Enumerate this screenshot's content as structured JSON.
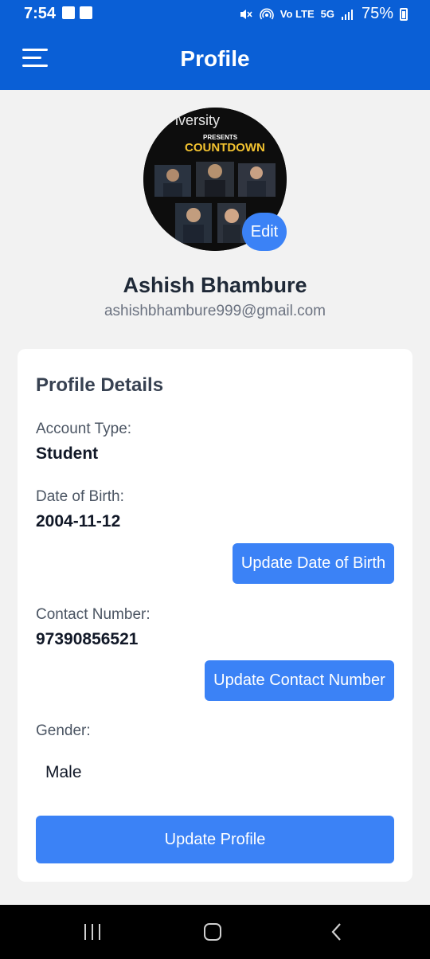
{
  "status_bar": {
    "time": "7:54",
    "network": "5G",
    "battery": "75%"
  },
  "header": {
    "title": "Profile",
    "menu_icon": "hamburger-menu-icon"
  },
  "profile": {
    "avatar_text": {
      "line1": "iversity",
      "line2": "PRESENTS",
      "line3": "COUNTDOWN"
    },
    "edit_label": "Edit",
    "name": "Ashish Bhambure",
    "email": "ashishbhambure999@gmail.com"
  },
  "details": {
    "title": "Profile Details",
    "account_type_label": "Account Type:",
    "account_type_value": "Student",
    "dob_label": "Date of Birth:",
    "dob_value": "2004-11-12",
    "update_dob_label": "Update Date of Birth",
    "contact_label": "Contact Number:",
    "contact_value": "97390856521",
    "update_contact_label": "Update Contact Number",
    "gender_label": "Gender:",
    "gender_value": "Male",
    "update_profile_label": "Update Profile"
  },
  "colors": {
    "header": "#0a5fd6",
    "button": "#3b82f6",
    "background": "#f2f2f2"
  }
}
